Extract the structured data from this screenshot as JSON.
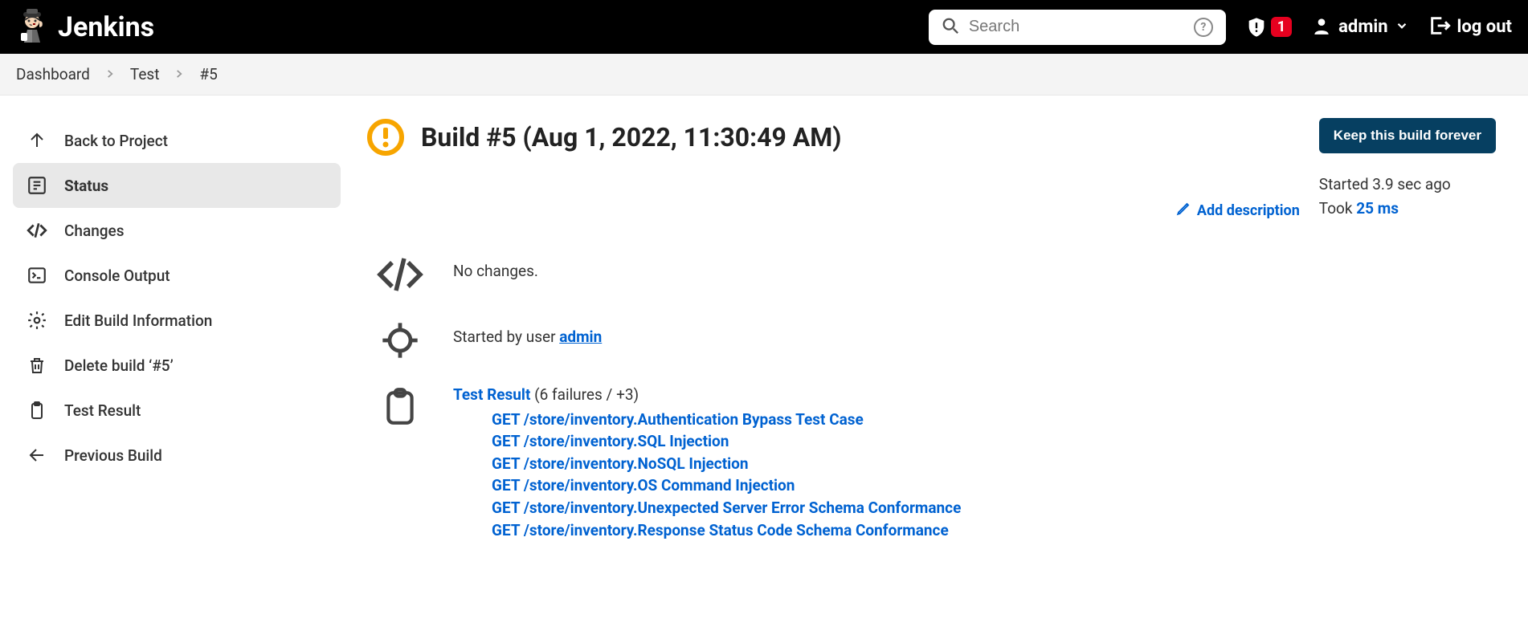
{
  "header": {
    "app_name": "Jenkins",
    "search_placeholder": "Search",
    "alert_count": "1",
    "user_name": "admin",
    "logout_label": "log out"
  },
  "breadcrumb": {
    "items": [
      "Dashboard",
      "Test",
      "#5"
    ]
  },
  "sidebar": {
    "items": [
      {
        "label": "Back to Project",
        "icon": "arrow-up"
      },
      {
        "label": "Status",
        "icon": "status",
        "active": true
      },
      {
        "label": "Changes",
        "icon": "code"
      },
      {
        "label": "Console Output",
        "icon": "terminal"
      },
      {
        "label": "Edit Build Information",
        "icon": "gear"
      },
      {
        "label": "Delete build ‘#5’",
        "icon": "trash"
      },
      {
        "label": "Test Result",
        "icon": "clipboard"
      },
      {
        "label": "Previous Build",
        "icon": "arrow-left"
      }
    ]
  },
  "main": {
    "title": "Build #5 (Aug 1, 2022, 11:30:49 AM)",
    "add_description": "Add description",
    "keep_button": "Keep this build forever",
    "meta_started": "Started 3.9 sec ago",
    "meta_took_prefix": "Took ",
    "meta_took_value": "25 ms",
    "no_changes": "No changes.",
    "started_by_prefix": "Started by user ",
    "started_by_user": "admin",
    "test_result_label": "Test Result",
    "test_result_summary": "(6 failures / +3)",
    "failures": [
      "GET /store/inventory.Authentication Bypass Test Case",
      "GET /store/inventory.SQL Injection",
      "GET /store/inventory.NoSQL Injection",
      "GET /store/inventory.OS Command Injection",
      "GET /store/inventory.Unexpected Server Error Schema Conformance",
      "GET /store/inventory.Response Status Code Schema Conformance"
    ]
  },
  "colors": {
    "link": "#0062d1",
    "warn": "#f7a500",
    "alert": "#e6001f",
    "btn_dark": "#063f61"
  }
}
